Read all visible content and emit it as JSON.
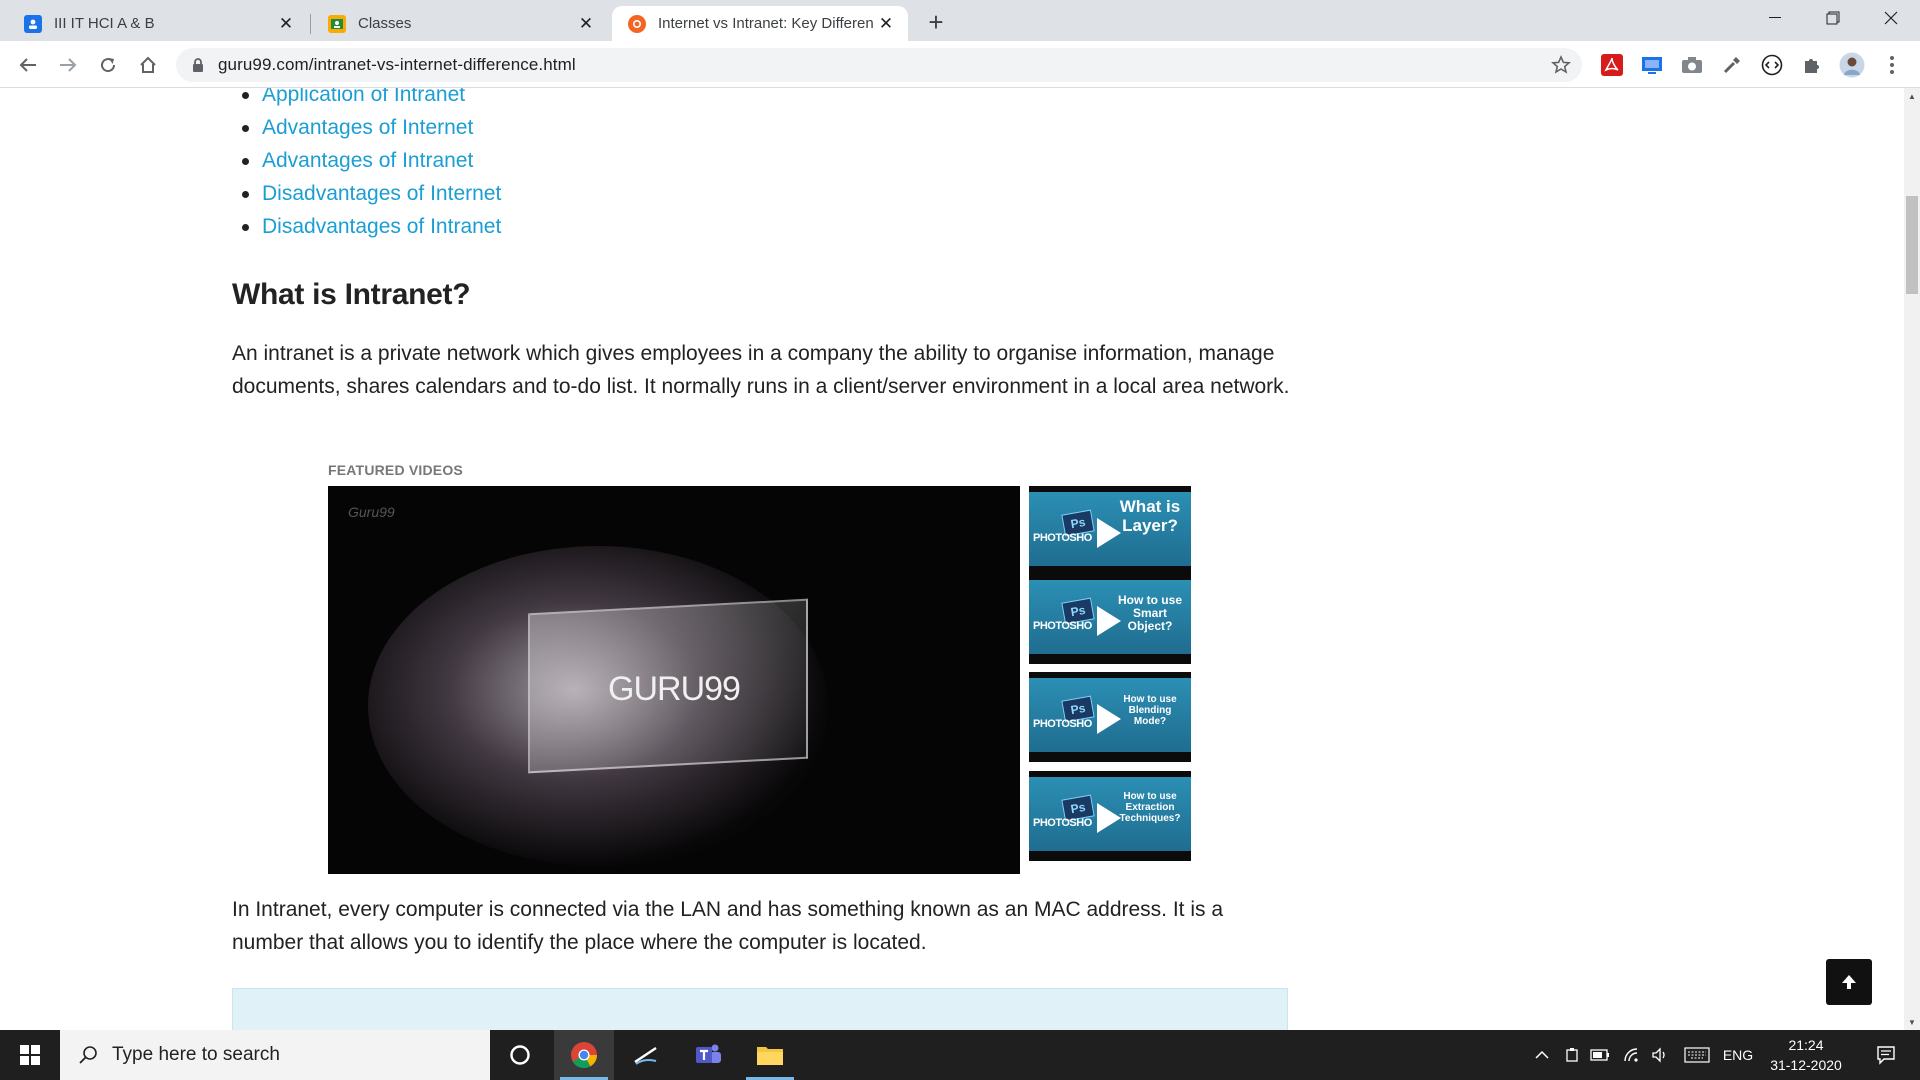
{
  "browser": {
    "tabs": [
      {
        "title": "III IT HCI A & B"
      },
      {
        "title": "Classes"
      },
      {
        "title": "Internet vs Intranet: Key Differen"
      }
    ],
    "url": "guru99.com/intranet-vs-internet-difference.html"
  },
  "page": {
    "toc": [
      "Application of Intranet",
      "Advantages of Internet",
      "Advantages of Intranet",
      "Disadvantages of Internet",
      "Disadvantages of Intranet"
    ],
    "heading": "What is Intranet?",
    "para1": "An intranet is a private network which gives employees in a company the ability to organise information, manage documents, shares calendars and to-do list. It normally runs in a client/server environment in a local area network.",
    "featured_label": "FEATURED VIDEOS",
    "video": {
      "brand": "GURU99",
      "watermark": "Guru99"
    },
    "thumbs": [
      {
        "badge": "Ps",
        "label": "PHOTOSHO",
        "caption": "What is Layer?"
      },
      {
        "badge": "Ps",
        "label": "PHOTOSHO",
        "caption": "How to use Smart Object?"
      },
      {
        "badge": "Ps",
        "label": "PHOTOSHO",
        "caption": "How to use Blending Mode?"
      },
      {
        "badge": "Ps",
        "label": "PHOTOSHO",
        "caption": "How to use Extraction Techniques?"
      }
    ],
    "para2": "In Intranet, every computer is connected via the LAN and has something known as an MAC address. It is a number that allows you to identify the place where the computer is located."
  },
  "taskbar": {
    "search_placeholder": "Type here to search",
    "language": "ENG",
    "time": "21:24",
    "date": "31-12-2020"
  }
}
